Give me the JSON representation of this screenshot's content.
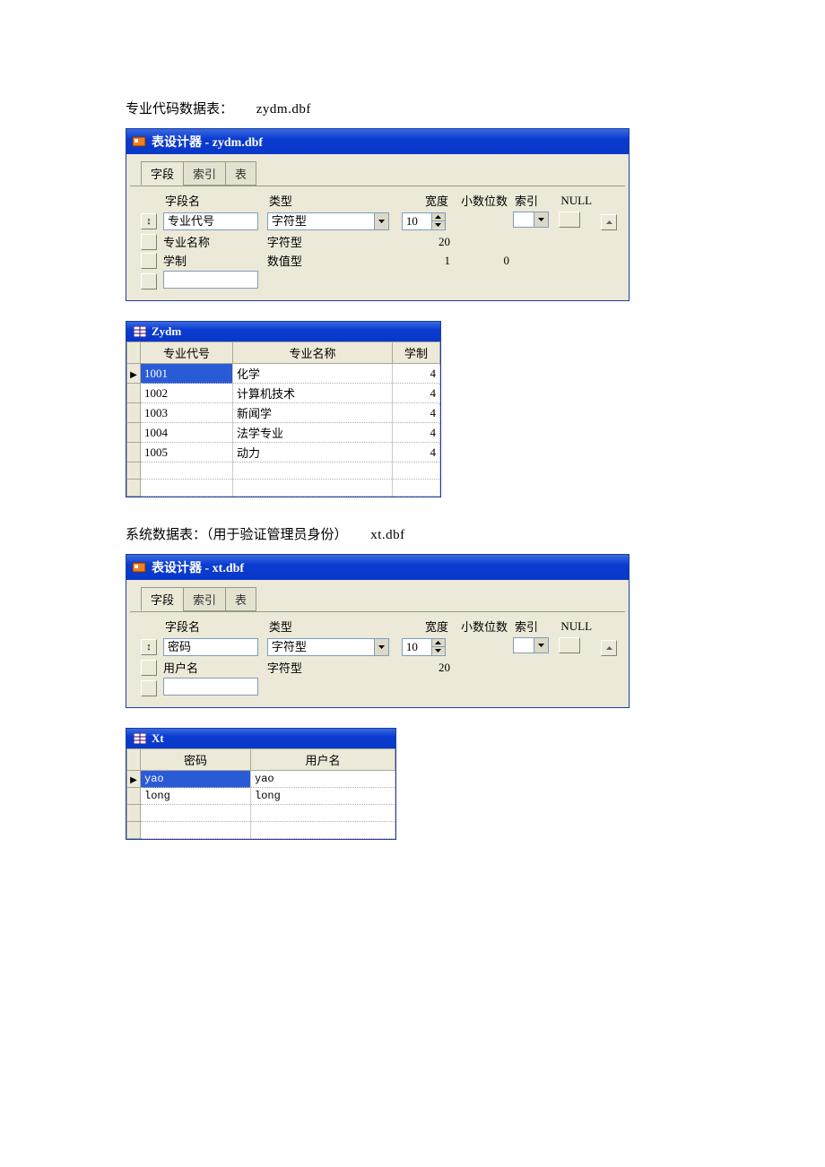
{
  "section1": {
    "caption": "专业代码数据表：",
    "filename": "zydm.dbf"
  },
  "designer1": {
    "title": "表设计器 - zydm.dbf",
    "tabs": {
      "fields": "字段",
      "index": "索引",
      "table": "表"
    },
    "headers": {
      "name": "字段名",
      "type": "类型",
      "width": "宽度",
      "decimal": "小数位数",
      "index": "索引",
      "null": "NULL"
    },
    "rows": [
      {
        "name": "专业代号",
        "type": "字符型",
        "width": "10",
        "decimal": "",
        "active": true
      },
      {
        "name": "专业名称",
        "type": "字符型",
        "width": "20",
        "decimal": ""
      },
      {
        "name": "学制",
        "type": "数值型",
        "width": "1",
        "decimal": "0"
      }
    ]
  },
  "browse1": {
    "title": "Zydm",
    "cols": [
      "专业代号",
      "专业名称",
      "学制"
    ],
    "rows": [
      {
        "c": [
          "1001",
          "化学",
          "4"
        ],
        "selected": true
      },
      {
        "c": [
          "1002",
          "计算机技术",
          "4"
        ]
      },
      {
        "c": [
          "1003",
          "新闻学",
          "4"
        ]
      },
      {
        "c": [
          "1004",
          "法学专业",
          "4"
        ]
      },
      {
        "c": [
          "1005",
          "动力",
          "4"
        ]
      }
    ]
  },
  "section2": {
    "caption": "系统数据表：（用于验证管理员身份）",
    "filename": "xt.dbf"
  },
  "designer2": {
    "title": "表设计器 - xt.dbf",
    "rows": [
      {
        "name": "密码",
        "type": "字符型",
        "width": "10",
        "decimal": "",
        "active": true
      },
      {
        "name": "用户名",
        "type": "字符型",
        "width": "20",
        "decimal": ""
      }
    ]
  },
  "browse2": {
    "title": "Xt",
    "cols": [
      "密码",
      "用户名"
    ],
    "rows": [
      {
        "c": [
          "yao",
          "yao"
        ],
        "selected": true
      },
      {
        "c": [
          "long",
          "long"
        ]
      }
    ]
  }
}
